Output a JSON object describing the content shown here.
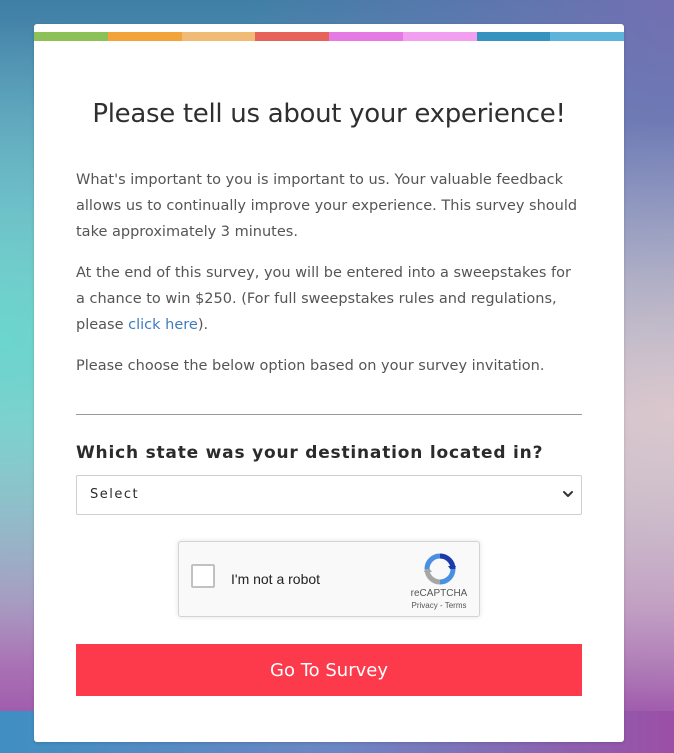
{
  "survey": {
    "title": "Please tell us about your experience!",
    "intro": "What's important to you is important to us. Your valuable feedback allows us to continually improve your experience. This survey should take approximately 3 minutes.",
    "sweepstakes_text": "At the end of this survey, you will be entered into a sweepstakes for a chance to win $250. (For full sweepstakes rules and regulations, please ",
    "sweepstakes_link": "click here",
    "sweepstakes_end": ").",
    "instructions": "Please choose the below option based on your survey invitation.",
    "question": "Which state was your destination located in?",
    "select_value": "Select",
    "submit_label": "Go To Survey"
  },
  "recaptcha": {
    "label": "I'm not a robot",
    "brand": "reCAPTCHA",
    "privacy": "Privacy",
    "separator": " - ",
    "terms": "Terms"
  },
  "colors": {
    "stripes": [
      "#8bc157",
      "#f2a33a",
      "#f0bb74",
      "#e6625b",
      "#e57ae2",
      "#f29ff0",
      "#3692bf",
      "#5db3dc"
    ],
    "button": "#fc3a4c",
    "link": "#3f7bbf"
  },
  "icons": {
    "select": "chevron-down-icon",
    "recaptcha": "recaptcha-logo-icon"
  }
}
